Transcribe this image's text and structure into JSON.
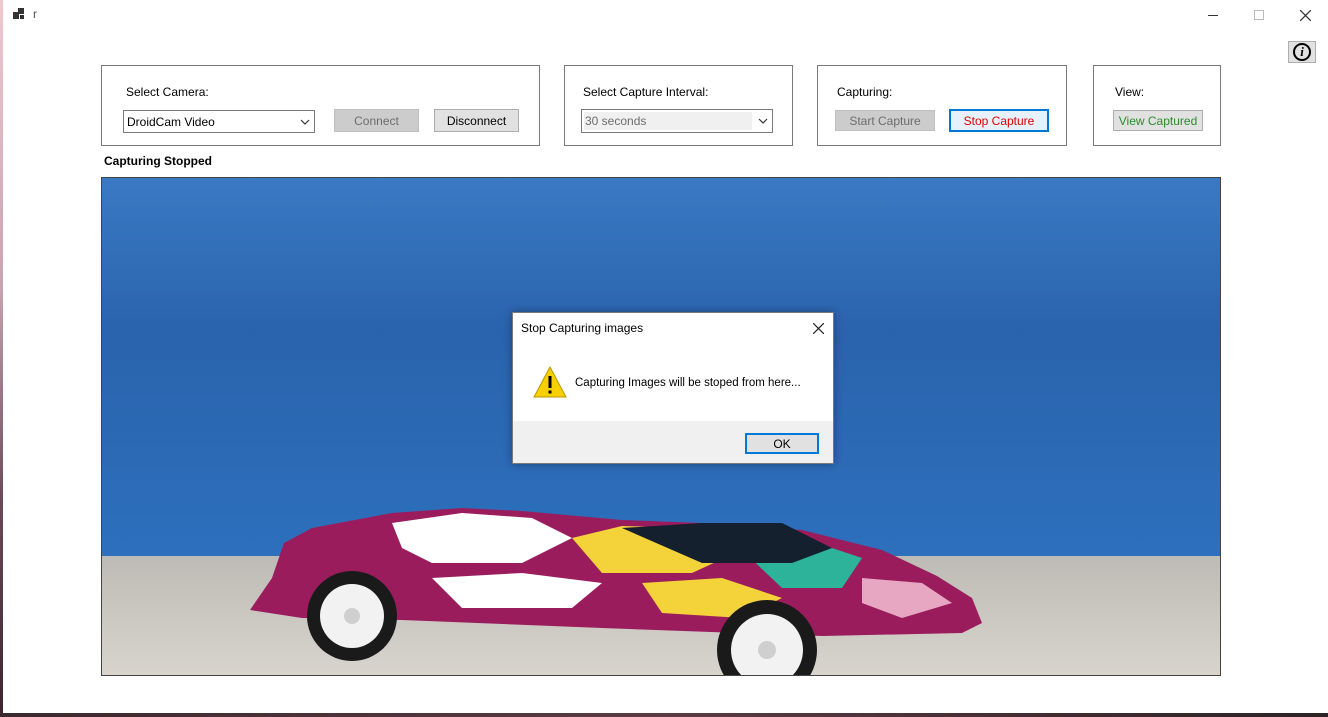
{
  "window": {
    "title": "r",
    "minimize_icon": "minimize-icon",
    "maximize_icon": "maximize-icon",
    "close_icon": "close-icon"
  },
  "info_button": {
    "label": "i",
    "icon": "info-icon"
  },
  "camera_group": {
    "label": "Select Camera:",
    "selected_camera": "DroidCam Video",
    "connect_label": "Connect",
    "disconnect_label": "Disconnect"
  },
  "interval_group": {
    "label": "Select Capture Interval:",
    "selected_interval": "30 seconds"
  },
  "capturing_group": {
    "label": "Capturing:",
    "start_label": "Start Capture",
    "stop_label": "Stop Capture"
  },
  "view_group": {
    "label": "View:",
    "view_label": "View Captured"
  },
  "status": "Capturing Stopped",
  "dialog": {
    "title": "Stop Capturing images",
    "message": "Capturing Images will be stoped from here...",
    "ok_label": "OK",
    "icon": "warning-icon"
  },
  "colors": {
    "stop_text": "#e00000",
    "view_text": "#2e8b2e",
    "focus_border": "#0078d7"
  }
}
